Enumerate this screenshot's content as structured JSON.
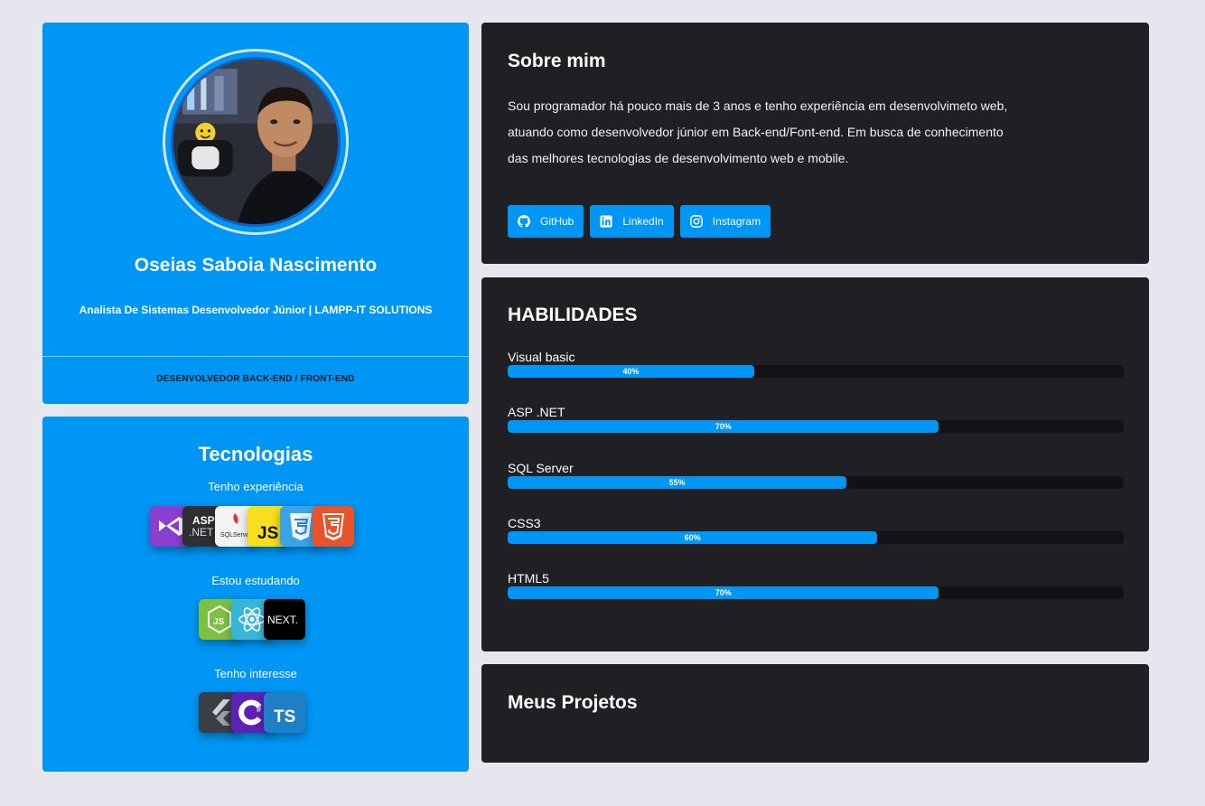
{
  "profile": {
    "name": "Oseias Saboia Nascimento",
    "role": "Analista De Sistemas Desenvolvedor Júnior | LAMPP-IT SOLUTIONS",
    "subtitle": "DESENVOLVEDOR BACK-END / FRONT-END"
  },
  "tech": {
    "title": "Tecnologias",
    "groups": [
      {
        "label": "Tenho experiência",
        "icons": [
          "visual-studio-icon",
          "asp-net-icon",
          "sql-server-icon",
          "javascript-icon",
          "css3-icon",
          "html5-icon"
        ]
      },
      {
        "label": "Estou estudando",
        "icons": [
          "nodejs-icon",
          "react-icon",
          "nextjs-icon"
        ]
      },
      {
        "label": "Tenho interesse",
        "icons": [
          "flutter-icon",
          "csharp-icon",
          "typescript-icon"
        ]
      }
    ],
    "tile_text": {
      "asp_line1": "ASP",
      "asp_line2": ".NET",
      "sql": "SQLServer",
      "js": "JS",
      "next": "NEXT.",
      "ts": "TS"
    }
  },
  "about": {
    "title": "Sobre mim",
    "lines": [
      "Sou programador há pouco mais de 3 anos e tenho experiência em desenvolvimeto web,",
      "atuando como desenvolvedor júnior em Back-end/Font-end. Em busca de conhecimento",
      "das melhores tecnologias de desenvolvimento web e mobile."
    ],
    "social": [
      {
        "label": "GitHub",
        "icon": "github-icon"
      },
      {
        "label": "LinkedIn",
        "icon": "linkedin-icon"
      },
      {
        "label": "Instagram",
        "icon": "instagram-icon"
      }
    ]
  },
  "skills": {
    "title": "HABILIDADES",
    "items": [
      {
        "name": "Visual basic",
        "percent": 40,
        "label": "40%"
      },
      {
        "name": "ASP .NET",
        "percent": 70,
        "label": "70%"
      },
      {
        "name": "SQL Server",
        "percent": 55,
        "label": "55%"
      },
      {
        "name": "CSS3",
        "percent": 60,
        "label": "60%"
      },
      {
        "name": "HTML5",
        "percent": 70,
        "label": "70%"
      }
    ]
  },
  "projects": {
    "title": "Meus Projetos"
  },
  "colors": {
    "accent": "#0096f5",
    "card_dark": "#202024",
    "background": "#e6e6ef"
  }
}
